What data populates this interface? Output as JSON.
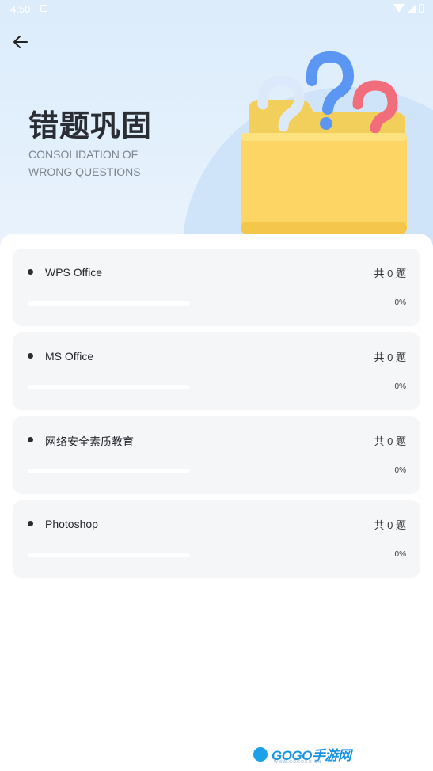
{
  "status_bar": {
    "time": "4:50"
  },
  "header": {
    "title": "错题巩固",
    "subtitle_line1": "CONSOLIDATION OF",
    "subtitle_line2": "WRONG QUESTIONS"
  },
  "items": [
    {
      "name": "WPS Office",
      "count": "共 0 题",
      "percent": "0%",
      "progress": 0
    },
    {
      "name": "MS Office",
      "count": "共 0 题",
      "percent": "0%",
      "progress": 0
    },
    {
      "name": "网络安全素质教育",
      "count": "共 0 题",
      "percent": "0%",
      "progress": 0
    },
    {
      "name": "Photoshop",
      "count": "共 0 题",
      "percent": "0%",
      "progress": 0
    }
  ],
  "colors": {
    "accent": "#4d8ef7",
    "hero_bg": "#dcecfb",
    "card_bg": "#f5f6f8"
  },
  "icons": [
    "back-arrow-icon",
    "question-mark-folder-illustration",
    "wifi-icon",
    "signal-icon",
    "battery-icon"
  ],
  "watermark": {
    "brand": "GOGO手游网",
    "url": "WWW.GOGOGO.CN"
  }
}
